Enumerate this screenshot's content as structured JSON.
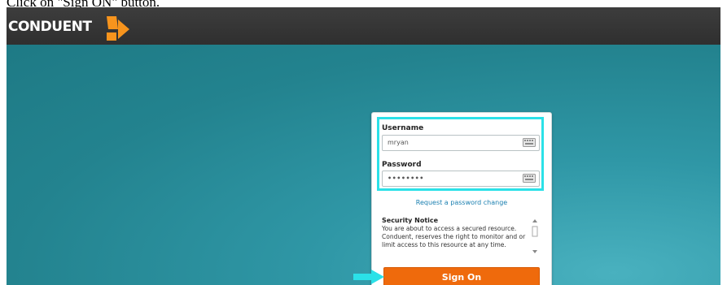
{
  "instruction": "Click on \"Sign ON\" button.",
  "brand": {
    "name": "CONDUENT"
  },
  "login": {
    "username_label": "Username",
    "username_value": "mryan",
    "password_label": "Password",
    "password_value": "••••••••",
    "request_link": "Request a password change",
    "notice_title": "Security Notice",
    "notice_text": "You are about to access a secured resource. Conduent, reserves the right to monitor and or limit access to this resource at any time.",
    "signon_label": "Sign On"
  },
  "icons": [
    "conduent-logo-icon",
    "keyboard-icon",
    "pointer-arrow-icon"
  ],
  "colors": {
    "topbar": "#333333",
    "background": "#2a8e9b",
    "signon_button": "#ef6a0c",
    "highlight": "#2be1e8",
    "link": "#1a7fb0"
  }
}
